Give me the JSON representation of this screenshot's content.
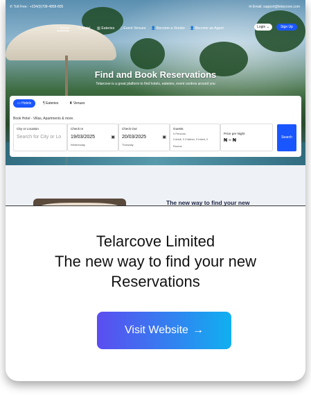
{
  "topbar": {
    "phone": "✆ Toll Free : +234(0)708-4858-805",
    "email": "✉ Email: support@telarcove.com"
  },
  "nav": {
    "items": [
      "Home",
      "Hotel",
      "Eateries",
      "Event Venues",
      "Become a Vendor",
      "Become an Agent"
    ],
    "login": "Login ⌄",
    "signup": "Sign Up"
  },
  "hero": {
    "title": "Find and Book Reservations",
    "subtitle": "Telarcove is a great platform to find hotels, eateries, event centres around you"
  },
  "search": {
    "tabs": [
      "Hotels",
      "Eateries",
      "Venues"
    ],
    "subline": "Book Hotel - Villas, Apartments & more.",
    "city_label": "City or Location",
    "city_placeholder": "Search for City or Lo",
    "checkin_label": "Check In",
    "checkin_value": "19/03/2025",
    "checkin_day": "Wednesday",
    "checkout_label": "Check Out",
    "checkout_value": "20/03/2025",
    "checkout_day": "Thursday",
    "guests_label": "Guests",
    "guests_value": "0 Persons",
    "guests_sub": "0 Adult, 0 Children, 0 Infant, 0",
    "guests_rooms": "Rooms",
    "price_label": "Price per Night",
    "price_value": "₦ – ₦",
    "button": "Search"
  },
  "below": {
    "tagline": "The new way to find your new"
  },
  "card": {
    "title_line1": "Telarcove Limited",
    "title_line2": "The new way to find your new",
    "title_line3": "Reservations",
    "cta": "Visit Website",
    "cta_arrow": "→"
  }
}
